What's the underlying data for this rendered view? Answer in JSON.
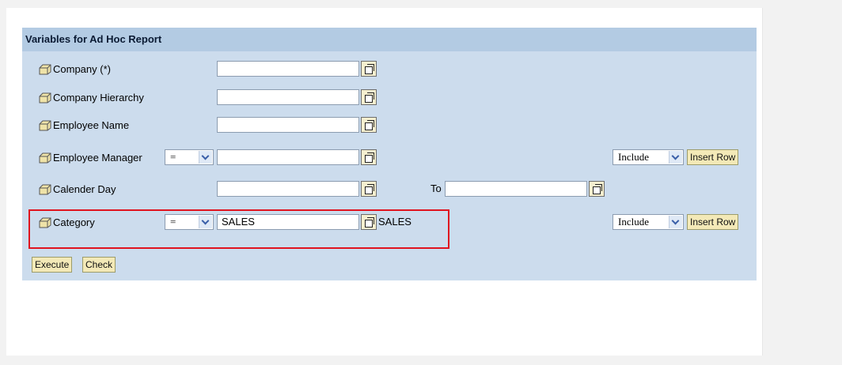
{
  "panel": {
    "title": "Variables for Ad Hoc Report"
  },
  "rows": {
    "company": {
      "label": "Company (*)",
      "value": ""
    },
    "company_hierarchy": {
      "label": "Company Hierarchy",
      "value": ""
    },
    "employee_name": {
      "label": "Employee Name",
      "value": ""
    },
    "employee_manager": {
      "label": "Employee Manager",
      "operator": "=",
      "value": "",
      "include": "Include",
      "insert_row": "Insert Row"
    },
    "calender_day": {
      "label": "Calender Day",
      "value": "",
      "to_label": "To",
      "to_value": ""
    },
    "category": {
      "label": "Category",
      "operator": "=",
      "value": "SALES",
      "value_text": "SALES",
      "include": "Include",
      "insert_row": "Insert Row"
    }
  },
  "actions": {
    "execute": "Execute",
    "check": "Check"
  },
  "colors": {
    "panel_bg": "#ccdced",
    "header_bg": "#b3cbe3",
    "button_bg": "#f3e9b7",
    "highlight": "#e0141f"
  },
  "icons": {
    "variable": "cube-icon",
    "value_help": "value-help-icon",
    "dropdown": "chevron-down-icon"
  }
}
